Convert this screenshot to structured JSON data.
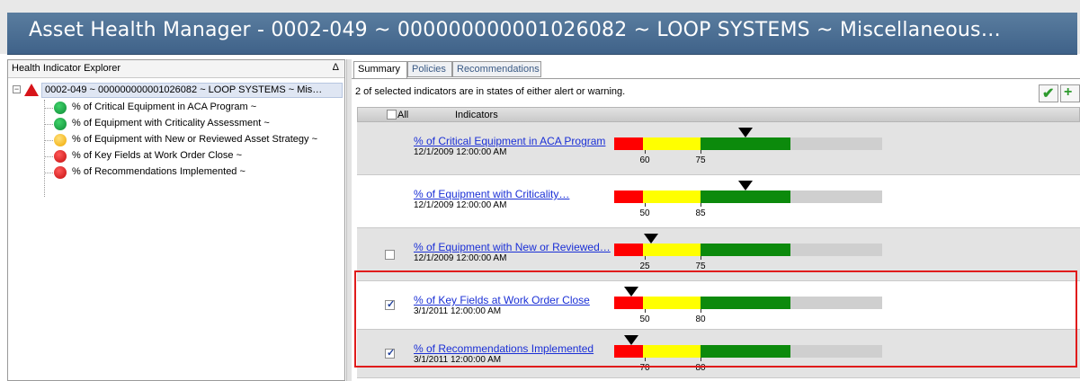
{
  "window": {
    "title": "Asset Health Manager - 0002-049 ~ 000000000001026082 ~ LOOP SYSTEMS ~ Miscellaneous…"
  },
  "left": {
    "header": "Health Indicator Explorer",
    "sort_glyph": "Δ",
    "root_label": "0002-049 ~ 000000000001026082 ~ LOOP SYSTEMS ~ Mis…",
    "items": [
      {
        "label": "% of Critical Equipment in ACA Program ~",
        "status": "green"
      },
      {
        "label": "% of Equipment with Criticality Assessment ~",
        "status": "green"
      },
      {
        "label": "% of Equipment with New or Reviewed Asset Strategy ~",
        "status": "yellow"
      },
      {
        "label": "% of Key Fields at Work Order Close ~",
        "status": "red"
      },
      {
        "label": "% of Recommendations Implemented ~",
        "status": "red"
      }
    ]
  },
  "tabs": [
    {
      "label": "Summary",
      "active": true
    },
    {
      "label": "Policies",
      "active": false
    },
    {
      "label": "Recommendations",
      "active": false
    }
  ],
  "summary_text": "2 of selected indicators are in states of either alert or warning.",
  "list_header": {
    "all_label": "All",
    "indicators_label": "Indicators"
  },
  "indicators": [
    {
      "name": "% of Critical Equipment in ACA Program",
      "date": "12/1/2009 12:00:00 AM",
      "checkbox": false,
      "checked": false,
      "low": "60",
      "high": "75",
      "marker_fraction": 0.4906,
      "row": "grey"
    },
    {
      "name": "% of Equipment with Criticality…",
      "date": "12/1/2009 12:00:00 AM",
      "checkbox": false,
      "checked": false,
      "low": "50",
      "high": "85",
      "marker_fraction": 0.4906,
      "row": "white"
    },
    {
      "name": "% of Equipment with New or Reviewed…",
      "date": "12/1/2009 12:00:00 AM",
      "checkbox": true,
      "checked": false,
      "low": "25",
      "high": "75",
      "marker_fraction": 0.1375,
      "row": "grey"
    },
    {
      "name": "% of Key Fields at Work Order Close",
      "date": "3/1/2011 12:00:00 AM",
      "checkbox": true,
      "checked": true,
      "low": "50",
      "high": "80",
      "marker_fraction": 0.0625,
      "row": "white"
    },
    {
      "name": "% of Recommendations Implemented",
      "date": "3/1/2011 12:00:00 AM",
      "checkbox": true,
      "checked": true,
      "low": "70",
      "high": "80",
      "marker_fraction": 0.0625,
      "row": "grey"
    }
  ],
  "colors": {
    "alert": "#ff0000",
    "warning": "#ffff00",
    "normal": "#0c8a0c",
    "title_bar": "#4a6d94",
    "link": "#1a2fd6",
    "highlight": "#e01b1b"
  }
}
